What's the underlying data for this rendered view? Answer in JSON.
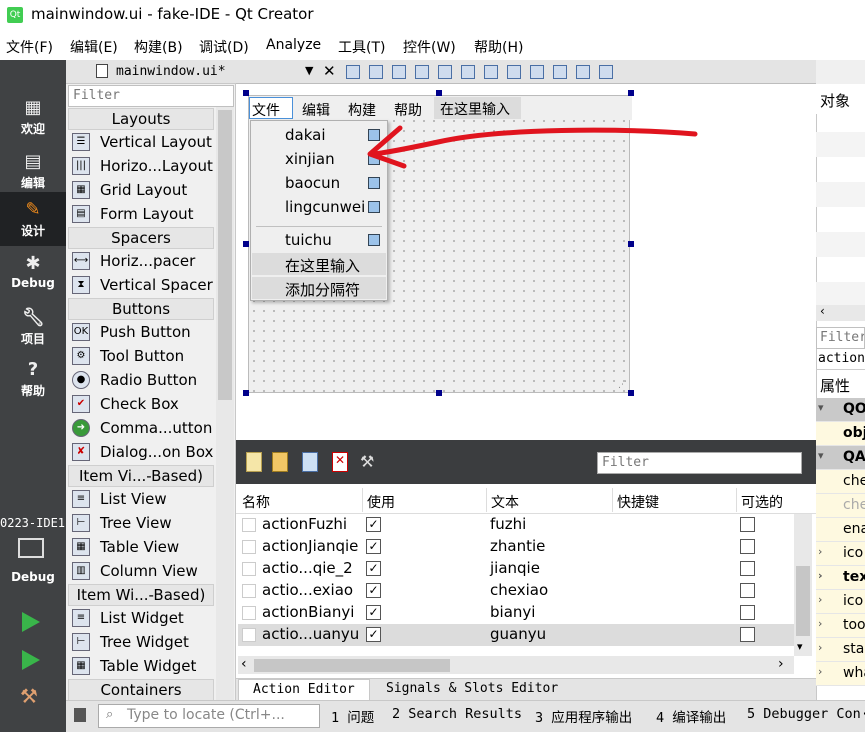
{
  "window": {
    "title": "mainwindow.ui - fake-IDE - Qt Creator",
    "app_icon_text": "Qt"
  },
  "menubar": [
    "文件(F)",
    "编辑(E)",
    "构建(B)",
    "调试(D)",
    "Analyze",
    "工具(T)",
    "控件(W)",
    "帮助(H)"
  ],
  "modes": [
    {
      "label": "欢迎",
      "icon": "grid-icon"
    },
    {
      "label": "编辑",
      "icon": "document-icon"
    },
    {
      "label": "设计",
      "icon": "pencil-icon"
    },
    {
      "label": "Debug",
      "icon": "bug-icon"
    },
    {
      "label": "项目",
      "icon": "wrench-icon"
    },
    {
      "label": "帮助",
      "icon": "help-icon"
    }
  ],
  "kit": {
    "project": "0223-IDE1",
    "config": "Debug"
  },
  "editor": {
    "file_tab": "mainwindow.ui*"
  },
  "widget_box": {
    "filter_placeholder": "Filter",
    "categories": {
      "layouts": "Layouts",
      "spacers": "Spacers",
      "buttons": "Buttons",
      "item_views": "Item Vi...-Based)",
      "item_widgets": "Item Wi...-Based)",
      "containers": "Containers"
    },
    "layouts": [
      "Vertical Layout",
      "Horizo...Layout",
      "Grid Layout",
      "Form Layout"
    ],
    "spacers": [
      "Horiz...pacer",
      "Vertical Spacer"
    ],
    "buttons": [
      "Push Button",
      "Tool Button",
      "Radio Button",
      "Check Box",
      "Comma...utton",
      "Dialog...on Box"
    ],
    "item_views": [
      "List View",
      "Tree View",
      "Table View",
      "Column View"
    ],
    "item_widgets": [
      "List Widget",
      "Tree Widget",
      "Table Widget"
    ]
  },
  "form": {
    "menus": [
      "文件",
      "编辑",
      "构建",
      "帮助"
    ],
    "menu_placeholder": "在这里输入",
    "dropdown": [
      "dakai",
      "xinjian",
      "baocun",
      "lingcunwei",
      "tuichu"
    ],
    "dropdown_type_here": "在这里输入",
    "dropdown_add_separator": "添加分隔符"
  },
  "object_inspector": {
    "header": "对象",
    "filter_placeholder": "Filter",
    "property_name": "action",
    "property_header": "属性",
    "rows": [
      {
        "text": "QOb",
        "type": "group",
        "expander": "▾"
      },
      {
        "text": "obj",
        "type": "bold",
        "expander": ""
      },
      {
        "text": "QAc",
        "type": "group",
        "expander": "▾"
      },
      {
        "text": "che",
        "type": "normal",
        "expander": ""
      },
      {
        "text": "che",
        "type": "dim",
        "expander": ""
      },
      {
        "text": "ena",
        "type": "normal",
        "expander": ""
      },
      {
        "text": "ico",
        "type": "normal",
        "expander": "›"
      },
      {
        "text": "tex",
        "type": "bold",
        "expander": "›"
      },
      {
        "text": "ico",
        "type": "normal",
        "expander": "›"
      },
      {
        "text": "too",
        "type": "normal",
        "expander": "›"
      },
      {
        "text": "sta",
        "type": "normal",
        "expander": "›"
      },
      {
        "text": "wha",
        "type": "normal",
        "expander": "›"
      }
    ]
  },
  "action_editor": {
    "filter_placeholder": "Filter",
    "columns": [
      "名称",
      "使用",
      "文本",
      "快捷键",
      "可选的"
    ],
    "rows": [
      {
        "name": "actionFuzhi",
        "used": true,
        "text": "fuzhi",
        "checkable": false
      },
      {
        "name": "actionJianqie",
        "used": true,
        "text": "zhantie",
        "checkable": false
      },
      {
        "name": "actio...qie_2",
        "used": true,
        "text": "jianqie",
        "checkable": false
      },
      {
        "name": "actio...exiao",
        "used": true,
        "text": "chexiao",
        "checkable": false
      },
      {
        "name": "actionBianyi",
        "used": true,
        "text": "bianyi",
        "checkable": false
      },
      {
        "name": "actio...uanyu",
        "used": true,
        "text": "guanyu",
        "checkable": false
      }
    ]
  },
  "bottom_tabs": [
    "Action Editor",
    "Signals & Slots Editor"
  ],
  "statusbar": {
    "locator_placeholder": "Type to locate (Ctrl+...",
    "panes": [
      "1 问题",
      "2 Search Results",
      "3 应用程序输出",
      "4 编译输出",
      "5 Debugger Con·"
    ]
  },
  "colors": {
    "accent_red": "#e0141e",
    "modebar": "#404244",
    "selection_blue": "#4a90d9"
  }
}
